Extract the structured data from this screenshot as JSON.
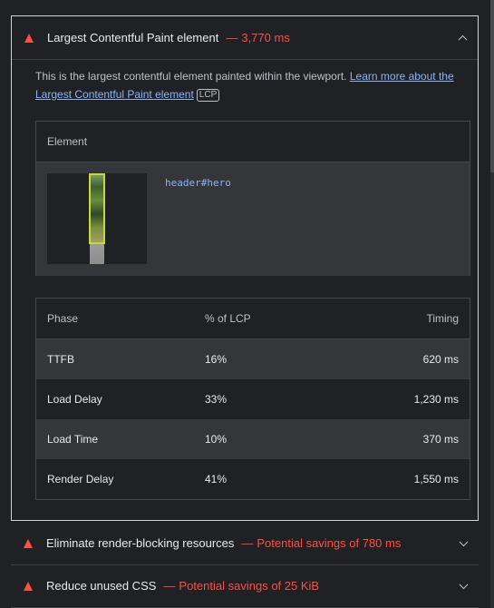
{
  "lcp_audit": {
    "title": "Largest Contentful Paint element",
    "separator": "—",
    "value": "3,770 ms",
    "description_text": "This is the largest contentful element painted within the viewport.",
    "learn_more_link": "Learn more about the Largest Contentful Paint element",
    "badge": "LCP",
    "element_table": {
      "header": "Element",
      "node": "header#hero"
    },
    "phase_table": {
      "headers": {
        "phase": "Phase",
        "pct": "% of LCP",
        "timing": "Timing"
      },
      "rows": [
        {
          "phase": "TTFB",
          "pct": "16%",
          "timing": "620 ms"
        },
        {
          "phase": "Load Delay",
          "pct": "33%",
          "timing": "1,230 ms"
        },
        {
          "phase": "Load Time",
          "pct": "10%",
          "timing": "370 ms"
        },
        {
          "phase": "Render Delay",
          "pct": "41%",
          "timing": "1,550 ms"
        }
      ]
    }
  },
  "collapsed_audits": [
    {
      "title": "Eliminate render-blocking resources",
      "separator": "—",
      "value": "Potential savings of 780 ms"
    },
    {
      "title": "Reduce unused CSS",
      "separator": "—",
      "value": "Potential savings of 25 KiB"
    }
  ],
  "colors": {
    "fail": "#ff4e42",
    "link": "#8ab4f8",
    "background": "#202124",
    "row_shade": "#35363a"
  },
  "icons": {
    "fail": "warning-triangle-icon",
    "expand": "chevron-up-icon",
    "collapse": "chevron-down-icon"
  }
}
